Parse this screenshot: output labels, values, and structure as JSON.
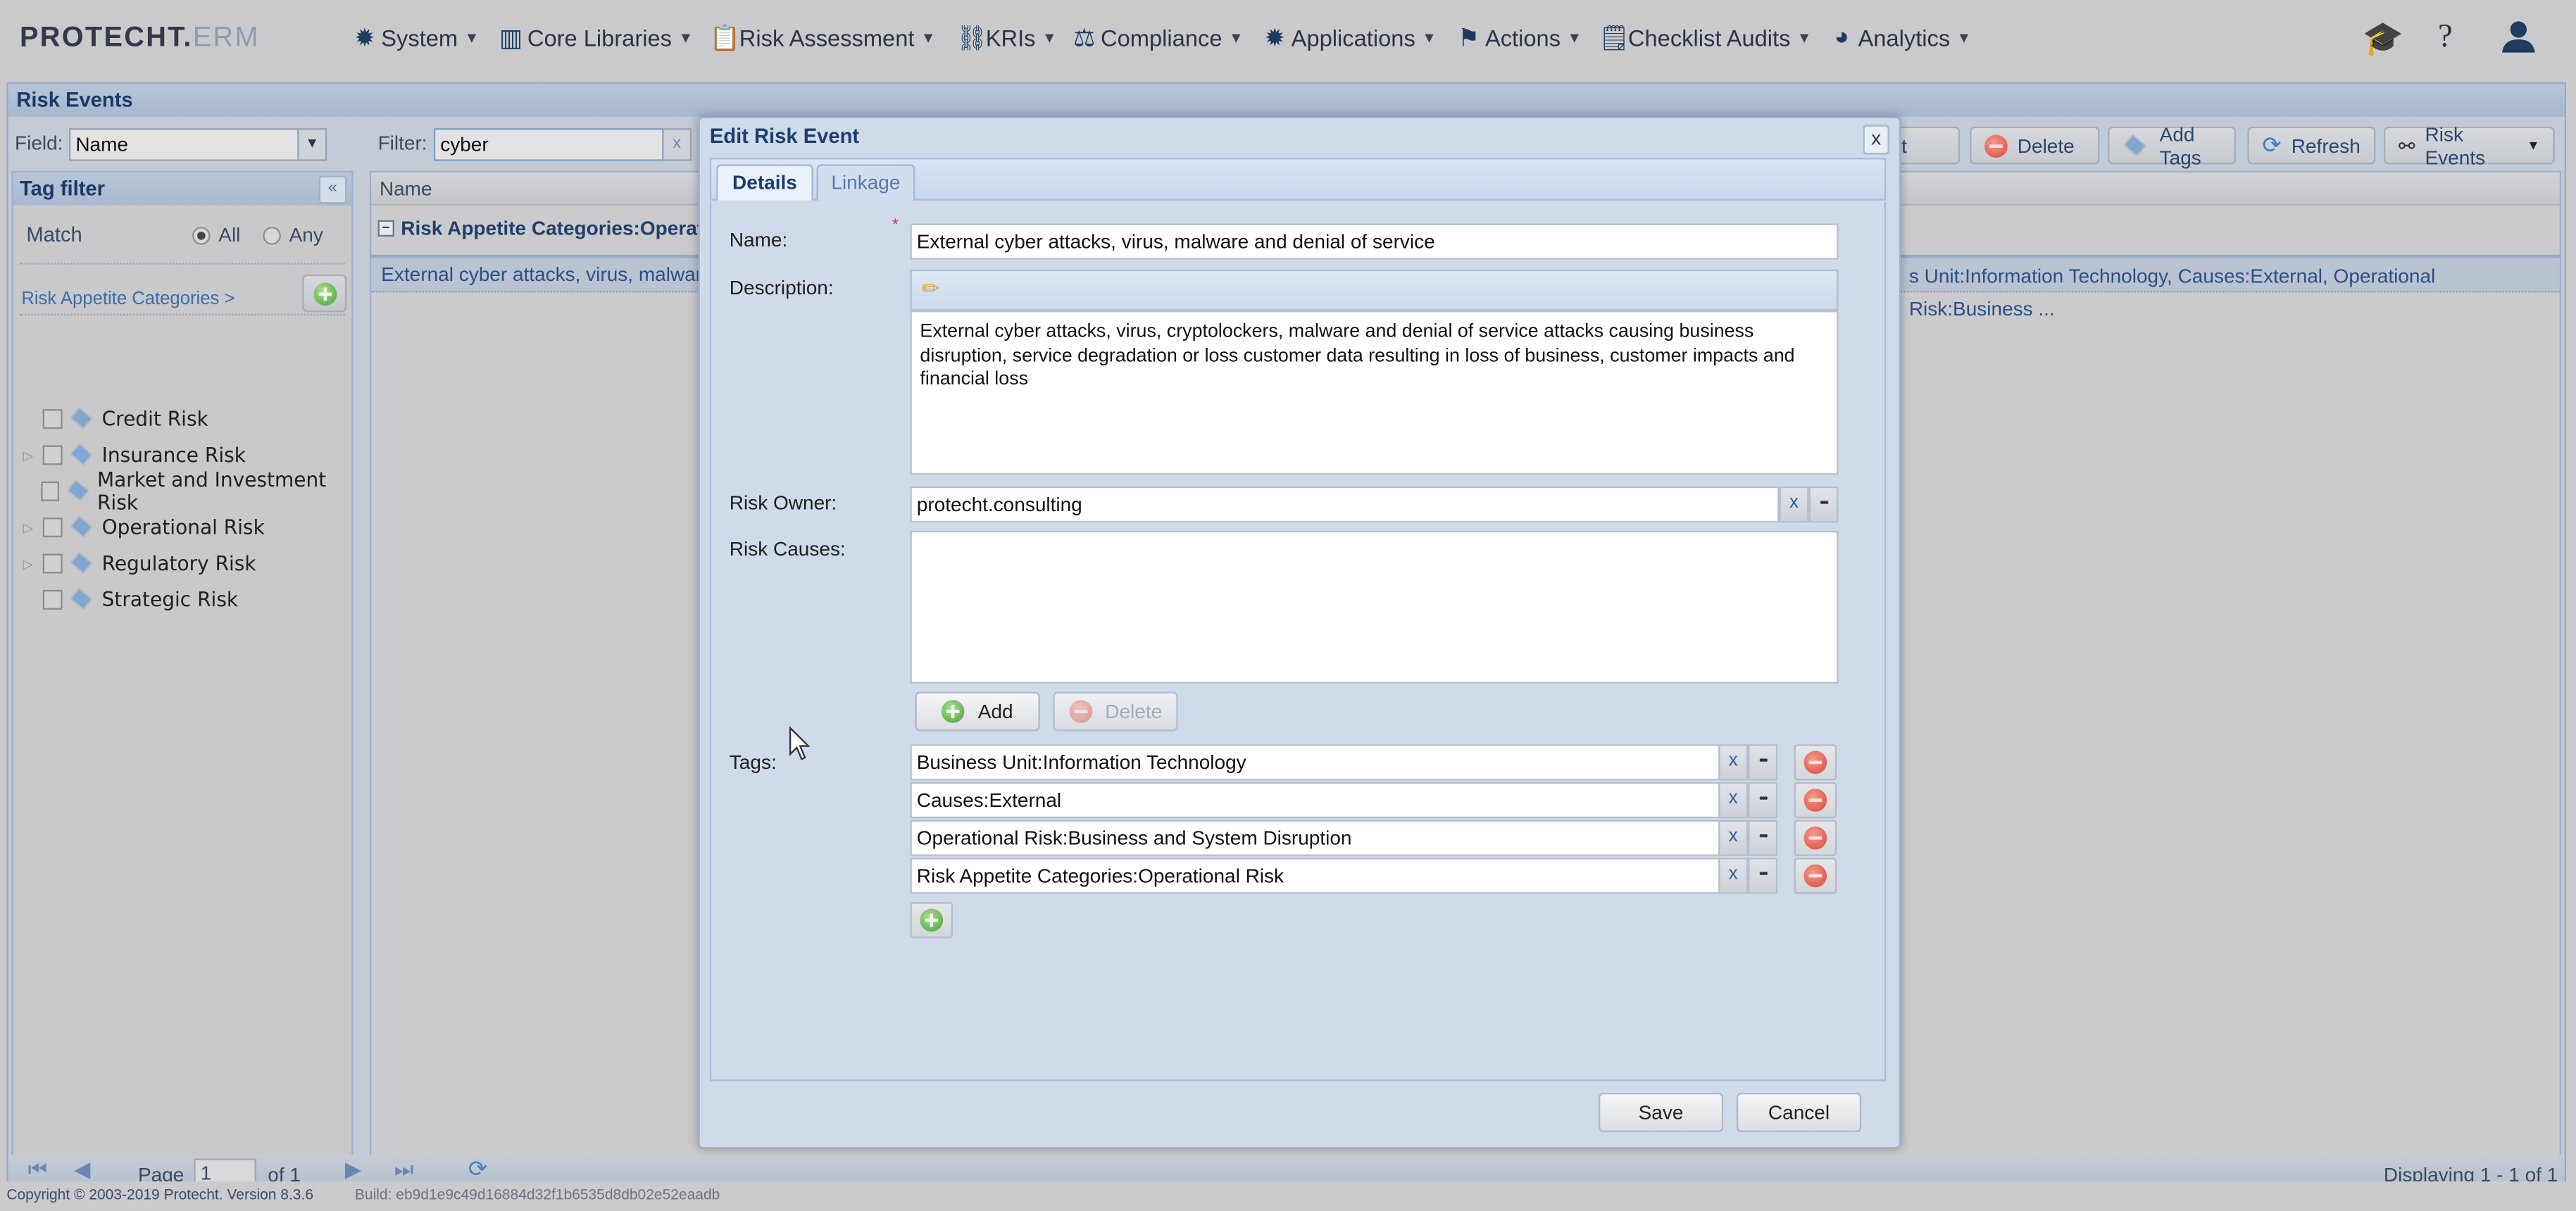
{
  "app": {
    "logo_main": "PROTECHT.",
    "logo_suffix": "ERM"
  },
  "nav": {
    "items": [
      {
        "label": "System",
        "icon": "gear-icon"
      },
      {
        "label": "Core Libraries",
        "icon": "library-icon"
      },
      {
        "label": "Risk Assessment",
        "icon": "clipboard-search-icon"
      },
      {
        "label": "KRIs",
        "icon": "chain-icon"
      },
      {
        "label": "Compliance",
        "icon": "gavel-icon"
      },
      {
        "label": "Applications",
        "icon": "gear-icon"
      },
      {
        "label": "Actions",
        "icon": "flag-icon"
      },
      {
        "label": "Checklist Audits",
        "icon": "checklist-icon"
      },
      {
        "label": "Analytics",
        "icon": "pie-chart-icon"
      }
    ],
    "right_icons": [
      "graduation-cap-icon",
      "help-icon",
      "user-icon"
    ],
    "help_glyph": "?"
  },
  "main_panel": {
    "title": "Risk Events",
    "field_label": "Field:",
    "field_value": "Name",
    "filter_label": "Filter:",
    "filter_value": "cyber",
    "clear_glyph": "x",
    "toolbar": {
      "edit_label": "Edit",
      "delete_label": "Delete",
      "add_tags_label": "Add Tags",
      "refresh_label": "Refresh",
      "risk_events_label": "Risk Events"
    }
  },
  "tag_filter": {
    "title": "Tag filter",
    "collapse_glyph": "«",
    "match_label": "Match",
    "match_options": [
      {
        "label": "All",
        "selected": true
      },
      {
        "label": "Any",
        "selected": false
      }
    ],
    "breadcrumb": "Risk Appetite Categories >",
    "items": [
      {
        "label": "Credit Risk",
        "expandable": false,
        "checked": false
      },
      {
        "label": "Insurance Risk",
        "expandable": true,
        "checked": false
      },
      {
        "label": "Market and Investment Risk",
        "expandable": false,
        "checked": false
      },
      {
        "label": "Operational Risk",
        "expandable": true,
        "checked": false
      },
      {
        "label": "Regulatory Risk",
        "expandable": true,
        "checked": false
      },
      {
        "label": "Strategic Risk",
        "expandable": false,
        "checked": false
      }
    ]
  },
  "grid": {
    "column_header": "Name",
    "group_label": "Risk Appetite Categories:Operat",
    "row_left_text": "External cyber attacks, virus, malware a",
    "row_right_text": "s Unit:Information Technology, Causes:External, Operational Risk:Business ..."
  },
  "paging": {
    "page_label": "Page",
    "page_value": "1",
    "of_label": "of 1",
    "display_info": "Displaying 1 - 1 of 1"
  },
  "footer": {
    "copyright": "Copyright © 2003-2019 Protecht.  Version 8.3.6",
    "build": "Build: eb9d1e9c49d16884d32f1b6535d8db02e52eaadb"
  },
  "dialog": {
    "title": "Edit Risk Event",
    "close_glyph": "x",
    "tabs": [
      {
        "label": "Details",
        "active": true
      },
      {
        "label": "Linkage",
        "active": false
      }
    ],
    "name_label": "Name:",
    "required_marker": "*",
    "name_value": "External cyber attacks, virus, malware and denial of service",
    "description_label": "Description:",
    "description_value": "External cyber attacks, virus, cryptolockers, malware and denial of service attacks causing business disruption, service degradation or loss customer data resulting in loss of business, customer impacts and financial loss",
    "risk_owner_label": "Risk Owner:",
    "risk_owner_value": "protecht.consulting",
    "risk_causes_label": "Risk Causes:",
    "add_label": "Add",
    "delete_label": "Delete",
    "tags_label": "Tags:",
    "tags": [
      "Business Unit:Information Technology",
      "Causes:External",
      "Operational Risk:Business and System Disruption",
      "Risk Appetite Categories:Operational Risk"
    ],
    "clear_glyph": "x",
    "browse_glyph": "•••",
    "save_label": "Save",
    "cancel_label": "Cancel"
  },
  "colors": {
    "brand_navy": "#1e3c60",
    "panel_header": "#a6b7cf",
    "dialog_bg": "#cfdaea",
    "delete_red": "#d9453a",
    "add_green": "#4e9e3a"
  }
}
